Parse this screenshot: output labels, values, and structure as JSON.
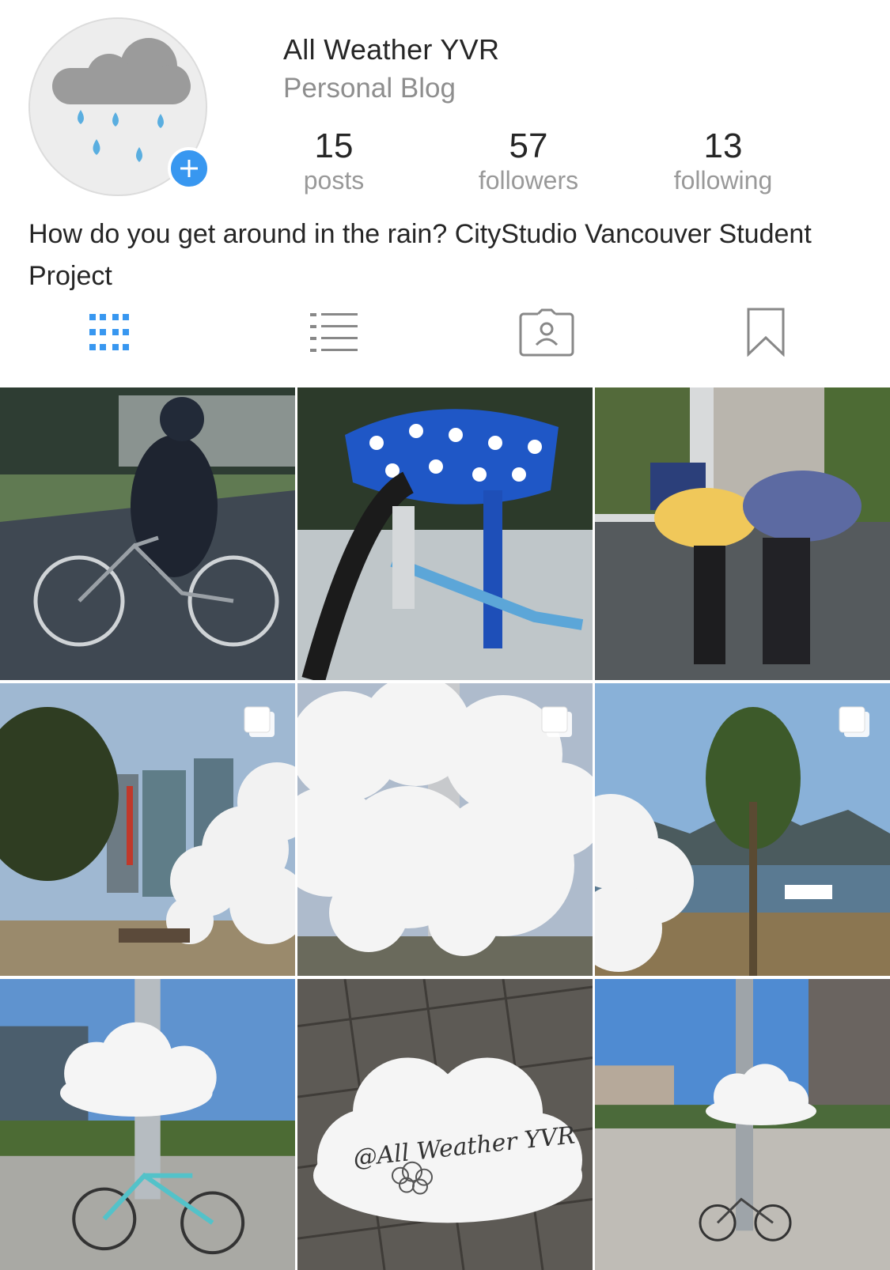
{
  "profile": {
    "username": "All Weather YVR",
    "category": "Personal Blog",
    "bio": "How do you get around in the rain? CityStudio Vancouver Student Project",
    "avatar_icon": "rain-cloud-icon",
    "add_icon": "plus-icon",
    "accent_color": "#3897f0"
  },
  "stats": {
    "posts": {
      "value": "15",
      "label": "posts"
    },
    "followers": {
      "value": "57",
      "label": "followers"
    },
    "following": {
      "value": "13",
      "label": "following"
    }
  },
  "tabs": [
    {
      "icon": "grid-icon",
      "active": true
    },
    {
      "icon": "list-icon",
      "active": false
    },
    {
      "icon": "tagged-person-icon",
      "active": false
    },
    {
      "icon": "bookmark-icon",
      "active": false
    }
  ],
  "posts": [
    {
      "subject": "cyclist in rain jacket",
      "multi": false
    },
    {
      "subject": "flowered bike seat cover",
      "multi": false
    },
    {
      "subject": "people with umbrellas",
      "multi": false
    },
    {
      "subject": "cloud sculpture with city",
      "multi": true
    },
    {
      "subject": "cloud sculpture close-up",
      "multi": true
    },
    {
      "subject": "cloud sculpture by water",
      "multi": true
    },
    {
      "subject": "cloud above bicycle",
      "multi": false
    },
    {
      "subject": "paper cloud note",
      "multi": false,
      "text": "@All Weather YVR"
    },
    {
      "subject": "cloud in plaza",
      "multi": false
    }
  ]
}
